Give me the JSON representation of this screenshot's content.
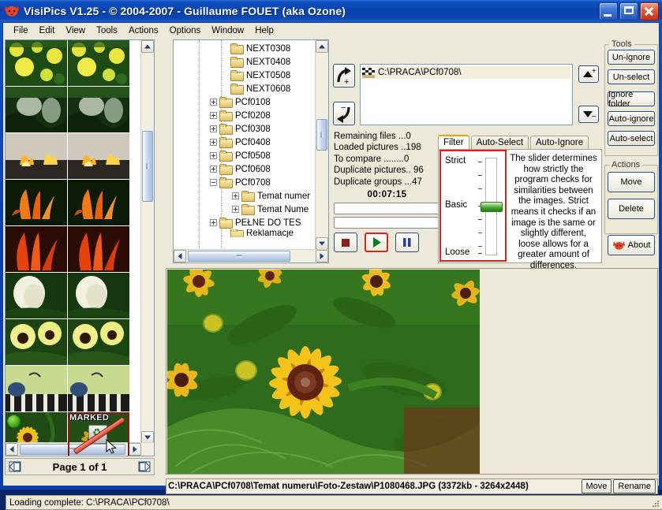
{
  "window": {
    "title": "VisiPics V1.25 - © 2004-2007 - Guillaume FOUET (aka Ozone)",
    "app_icon": "fox-icon",
    "minimize": "minimize-icon",
    "maximize": "maximize-icon",
    "close": "close-icon"
  },
  "menu": [
    "File",
    "Edit",
    "View",
    "Tools",
    "Actions",
    "Options",
    "Window",
    "Help"
  ],
  "thumbnails": {
    "rows": [
      {
        "id": "row-1",
        "marked": false
      },
      {
        "id": "row-2",
        "marked": false
      },
      {
        "id": "row-3",
        "marked": false
      },
      {
        "id": "row-4",
        "marked": false
      },
      {
        "id": "row-5",
        "marked": false
      },
      {
        "id": "row-6",
        "marked": false
      },
      {
        "id": "row-7",
        "marked": false
      },
      {
        "id": "row-8",
        "marked": true,
        "badge": "MARKED"
      },
      {
        "id": "row-9",
        "marked": false
      },
      {
        "id": "row-10",
        "marked": false
      }
    ],
    "marked_label": "MARKED"
  },
  "pager": {
    "label": "Page 1 of 1",
    "prev_icon": "page-prev-icon",
    "next_icon": "page-next-icon"
  },
  "tree": {
    "nodes": [
      {
        "label": "NEXT0308",
        "expander": "none",
        "indent": 3
      },
      {
        "label": "NEXT0408",
        "expander": "none",
        "indent": 3
      },
      {
        "label": "NEXT0508",
        "expander": "none",
        "indent": 3
      },
      {
        "label": "NEXT0608",
        "expander": "none",
        "indent": 3
      },
      {
        "label": "PCf0108",
        "expander": "plus",
        "indent": 2
      },
      {
        "label": "PCf0208",
        "expander": "plus",
        "indent": 2
      },
      {
        "label": "PCf0308",
        "expander": "plus",
        "indent": 2
      },
      {
        "label": "PCf0408",
        "expander": "plus",
        "indent": 2
      },
      {
        "label": "PCf0508",
        "expander": "plus",
        "indent": 2
      },
      {
        "label": "PCf0608",
        "expander": "plus",
        "indent": 2
      },
      {
        "label": "PCf0708",
        "expander": "minus",
        "indent": 2
      },
      {
        "label": "Temat numer",
        "expander": "plus",
        "indent": 4
      },
      {
        "label": "Temat Nume",
        "expander": "plus",
        "indent": 4
      },
      {
        "label": "PEŁNE DO TES",
        "expander": "plus",
        "indent": 2
      },
      {
        "label": "Reklamacje",
        "expander": "none",
        "indent": 3
      }
    ]
  },
  "folder_io": {
    "add_icon": "add-folder-arrow-icon",
    "remove_icon": "remove-folder-arrow-icon",
    "move_up_icon": "move-up-icon",
    "move_down_icon": "move-down-icon"
  },
  "path_list": {
    "items": [
      {
        "icon": "checkered-flag-icon",
        "path": "C:\\PRACA\\PCf0708\\"
      }
    ]
  },
  "stats": {
    "lines": [
      "Remaining files ...0",
      "Loaded pictures ..198",
      "To compare ........0",
      "Duplicate pictures.. 96",
      "Duplicate groups ...47"
    ],
    "timer": "00:07:15"
  },
  "transport": {
    "stop_icon": "stop-icon",
    "play_icon": "play-icon",
    "pause_icon": "pause-icon"
  },
  "tabs": [
    {
      "label": "Filter",
      "active": true
    },
    {
      "label": "Auto-Select",
      "active": false
    },
    {
      "label": "Auto-Ignore",
      "active": false
    }
  ],
  "filter": {
    "top_label": "Strict",
    "mid_label": "Basic",
    "bottom_label": "Loose",
    "description": "The slider determines how strictly the program checks for similarities between the images. Strict means it checks if an image is the same or slightly different, loose allows for a greater amount of differences."
  },
  "tools": {
    "title": "Tools",
    "buttons": [
      "Un-ignore",
      "Un-select",
      "Ignore folder",
      "Auto-ignore",
      "Auto-select"
    ]
  },
  "actions": {
    "title": "Actions",
    "buttons": [
      "Move",
      "Delete"
    ],
    "about": {
      "label": "About",
      "icon": "fox-icon"
    }
  },
  "image_info": {
    "text": "C:\\PRACA\\PCf0708\\Temat numeru\\Foto-Zestaw\\P1080468.JPG (3372kb - 3264x2448)",
    "buttons": [
      "Move",
      "Rename"
    ]
  },
  "statusbar": {
    "text": "Loading complete: C:\\PRACA\\PCf0708\\"
  },
  "colors": {
    "title_blue": "#0a43ae",
    "face": "#ece9d8",
    "highlight_red": "#e02020",
    "tab_orange": "#f0a400",
    "slider_green": "#3fa22a"
  }
}
